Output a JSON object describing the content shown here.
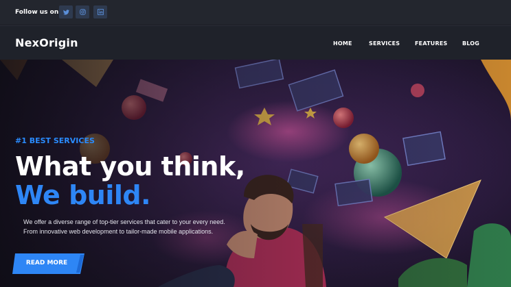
{
  "topbar": {
    "follow_label": "Follow us on :",
    "social": [
      {
        "icon": "twitter-icon"
      },
      {
        "icon": "instagram-icon"
      },
      {
        "icon": "linkedin-icon"
      }
    ]
  },
  "nav": {
    "logo": "NexOrigin",
    "links": [
      "HOME",
      "SERVICES",
      "FEATURES",
      "BLOG"
    ]
  },
  "hero": {
    "eyebrow": "#1 BEST SERVICES",
    "headline_line1": "What you think,",
    "headline_line2": "We build.",
    "description_line1": "We offer a diverse range of top-tier services that cater to your every need.",
    "description_line2": "From innovative web development to tailor-made mobile applications.",
    "cta_label": "READ MORE"
  },
  "colors": {
    "accent": "#2e86f5",
    "topbar_bg": "#23262e",
    "nav_bg": "#1f222a"
  }
}
